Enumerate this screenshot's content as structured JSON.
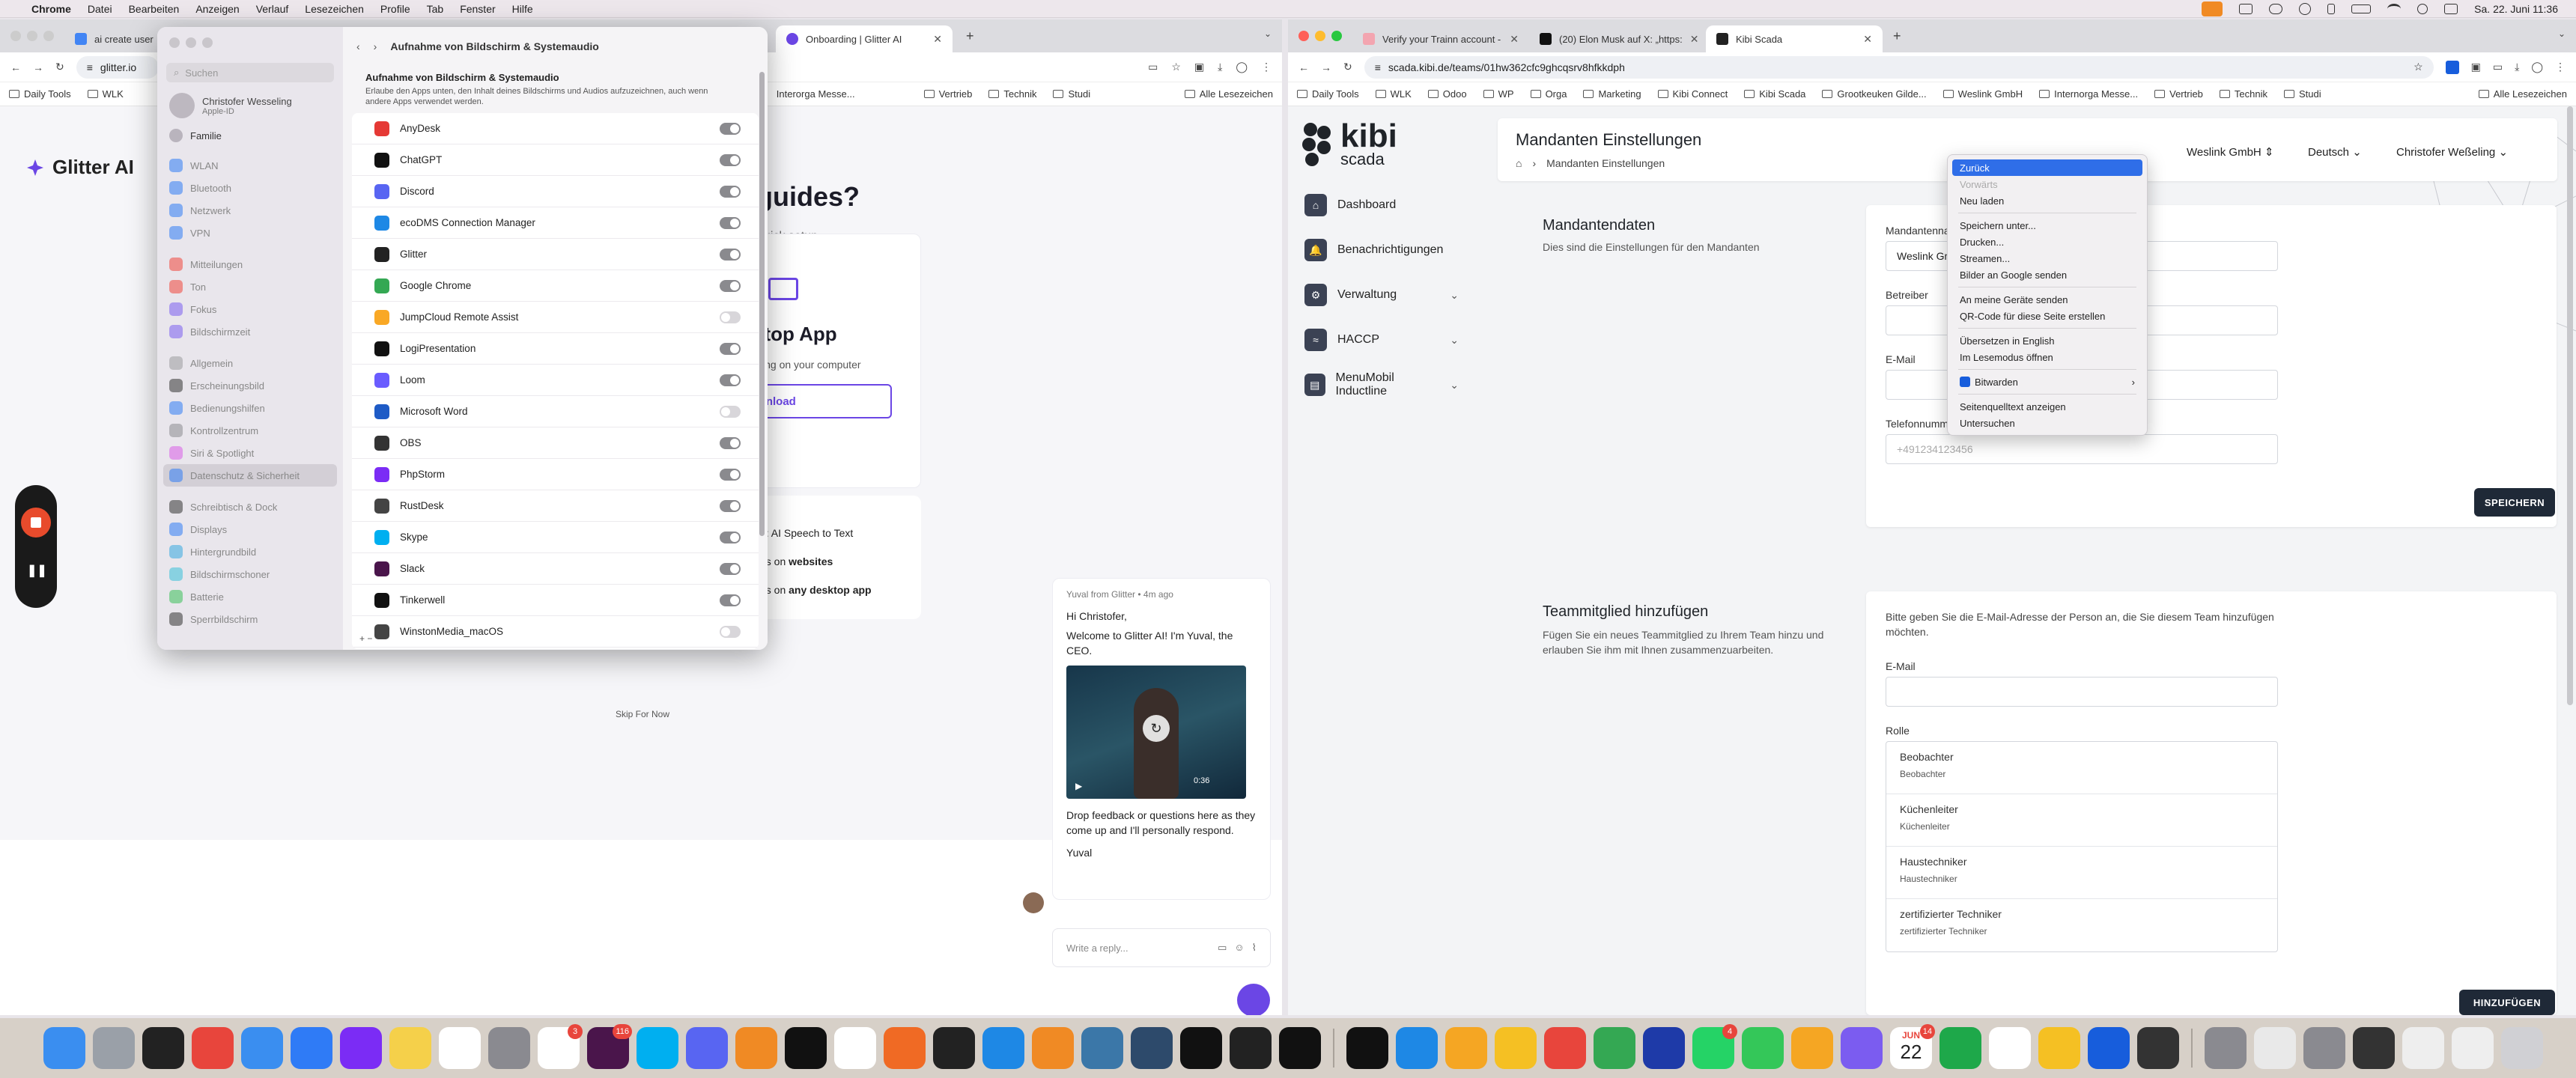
{
  "menubar": {
    "app": "Chrome",
    "items": [
      "Datei",
      "Bearbeiten",
      "Anzeigen",
      "Verlauf",
      "Lesezeichen",
      "Profile",
      "Tab",
      "Fenster",
      "Hilfe"
    ],
    "clock": "Sa. 22. Juni 11:36"
  },
  "left_browser": {
    "tabs": [
      {
        "title": "ai create user m"
      },
      {
        "title": "Onboarding | Glitter AI"
      }
    ],
    "url": "glitter.io",
    "bookmarks": [
      "Daily Tools",
      "WLK",
      "Interorga Messe...",
      "Vertrieb",
      "Technik",
      "Studi",
      "Alle Lesezeichen"
    ],
    "brand": "Glitter AI",
    "heading": "guides?",
    "subheading": "uick setup",
    "card_title": "ktop App",
    "card_desc": "ssing on your computer",
    "card_button": "ownload",
    "feature_lines": [
      {
        "prefix": "e: ",
        "bold": "",
        "rest": "AI Speech to Text"
      },
      {
        "prefix": "es on ",
        "bold": "websites",
        "rest": ""
      },
      {
        "prefix": "es on ",
        "bold": "any desktop app",
        "rest": ""
      }
    ],
    "skip": "Skip For Now",
    "chat": {
      "from": "Yuval from Glitter • 4m ago",
      "greeting": "Hi Christofer,",
      "welcome": "Welcome to Glitter AI! I'm Yuval, the CEO.",
      "video_time": "0:36",
      "feedback": "Drop feedback or questions here as they come up and I'll personally respond.",
      "sign": "Yuval",
      "reply_placeholder": "Write a reply..."
    }
  },
  "settings": {
    "search_placeholder": "Suchen",
    "user": {
      "name": "Christofer Wesseling",
      "sub": "Apple-ID"
    },
    "family": "Familie",
    "sidebar": [
      "WLAN",
      "Bluetooth",
      "Netzwerk",
      "VPN",
      "Mitteilungen",
      "Ton",
      "Fokus",
      "Bildschirmzeit",
      "Allgemein",
      "Erscheinungsbild",
      "Bedienungshilfen",
      "Kontrollzentrum",
      "Siri & Spotlight",
      "Datenschutz & Sicherheit",
      "Schreibtisch & Dock",
      "Displays",
      "Hintergrundbild",
      "Bildschirmschoner",
      "Batterie",
      "Sperrbildschirm"
    ],
    "title": "Aufnahme von Bildschirm & Systemaudio",
    "section_title": "Aufnahme von Bildschirm & Systemaudio",
    "section_desc": "Erlaube den Apps unten, den Inhalt deines Bildschirms und Audios aufzuzeichnen, auch wenn andere Apps verwendet werden.",
    "apps": [
      {
        "name": "AnyDesk",
        "on": true
      },
      {
        "name": "ChatGPT",
        "on": true
      },
      {
        "name": "Discord",
        "on": true
      },
      {
        "name": "ecoDMS Connection Manager",
        "on": true
      },
      {
        "name": "Glitter",
        "on": true
      },
      {
        "name": "Google Chrome",
        "on": true
      },
      {
        "name": "JumpCloud Remote Assist",
        "on": false
      },
      {
        "name": "LogiPresentation",
        "on": true
      },
      {
        "name": "Loom",
        "on": true
      },
      {
        "name": "Microsoft Word",
        "on": false
      },
      {
        "name": "OBS",
        "on": true
      },
      {
        "name": "PhpStorm",
        "on": true
      },
      {
        "name": "RustDesk",
        "on": true
      },
      {
        "name": "Skype",
        "on": true
      },
      {
        "name": "Slack",
        "on": true
      },
      {
        "name": "Tinkerwell",
        "on": true
      },
      {
        "name": "WinstonMedia_macOS",
        "on": false
      }
    ],
    "add_remove": "+  −"
  },
  "right_browser": {
    "tabs": [
      {
        "title": "Verify your Trainn account -"
      },
      {
        "title": "(20) Elon Musk auf X: „https:"
      },
      {
        "title": "Kibi Scada"
      }
    ],
    "url": "scada.kibi.de/teams/01hw362cfc9ghcqsrv8hfkkdph",
    "bookmarks": [
      "Daily Tools",
      "WLK",
      "Odoo",
      "WP",
      "Orga",
      "Marketing",
      "Kibi Connect",
      "Kibi Scada",
      "Grootkeuken Gilde...",
      "Weslink GmbH",
      "Internorga Messe...",
      "Vertrieb",
      "Technik",
      "Studi",
      "Alle Lesezeichen"
    ]
  },
  "kibi": {
    "logo": "kibi",
    "logo_sub": "scada",
    "nav": [
      {
        "label": "Dashboard",
        "chev": false
      },
      {
        "label": "Benachrichtigungen",
        "chev": false
      },
      {
        "label": "Verwaltung",
        "chev": true
      },
      {
        "label": "HACCP",
        "chev": true
      },
      {
        "label": "MenuMobil Inductline",
        "chev": true
      }
    ],
    "page_title": "Mandanten Einstellungen",
    "breadcrumb": "Mandanten Einstellungen",
    "org": "Weslink GmbH",
    "lang": "Deutsch",
    "user": "Christofer Weßeling",
    "mandant": {
      "title": "Mandantendaten",
      "desc": "Dies sind die Einstellungen für den Mandanten",
      "name_label": "Mandantenname",
      "name_value": "Weslink Gmb",
      "operator_label": "Betreiber",
      "email_label": "E-Mail",
      "phone_label": "Telefonnummer",
      "phone_placeholder": "+491234123456",
      "save": "SPEICHERN"
    },
    "team": {
      "title": "Teammitglied hinzufügen",
      "desc": "Fügen Sie ein neues Teammitglied zu Ihrem Team hinzu und erlauben Sie ihm mit Ihnen zusammenzuarbeiten.",
      "hint": "Bitte geben Sie die E-Mail-Adresse der Person an, die Sie diesem Team hinzufügen möchten.",
      "email_label": "E-Mail",
      "role_label": "Rolle",
      "roles": [
        {
          "t": "Beobachter",
          "s": "Beobachter"
        },
        {
          "t": "Küchenleiter",
          "s": "Küchenleiter"
        },
        {
          "t": "Haustechniker",
          "s": "Haustechniker"
        },
        {
          "t": "zertifizierter Techniker",
          "s": "zertifizierter Techniker"
        }
      ],
      "add": "HINZUFÜGEN"
    }
  },
  "context_menu": {
    "items": [
      "Zurück",
      "Vorwärts",
      "Neu laden",
      "Speichern unter...",
      "Drucken...",
      "Streamen...",
      "Bilder an Google senden",
      "An meine Geräte senden",
      "QR-Code für diese Seite erstellen",
      "Übersetzen in English",
      "Im Lesemodus öffnen",
      "Bitwarden",
      "Seitenquelltext anzeigen",
      "Untersuchen"
    ]
  },
  "dock": {
    "badges": [
      "3",
      "116",
      "4",
      "14"
    ],
    "calendar_month": "JUN",
    "calendar_day": "22"
  }
}
